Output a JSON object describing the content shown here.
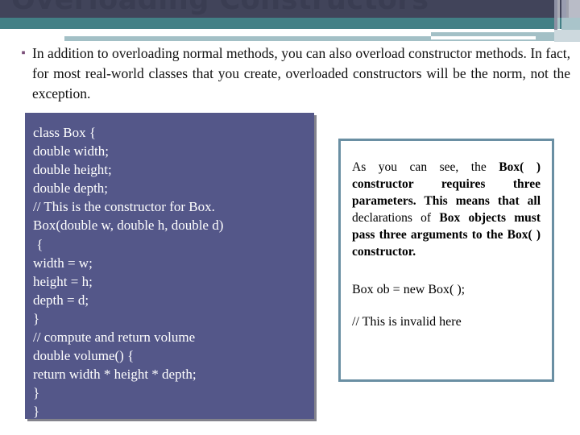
{
  "slide": {
    "title": "Overloading Constructors",
    "header": {
      "colors": {
        "navy": "#41445a",
        "teal": "#428086",
        "light_blue": "#a3c0c6",
        "stripe_gray": "#9a9db0",
        "title_text": "#3a3d52"
      }
    },
    "bullet": {
      "marker": "square-bullet-icon",
      "marker_glyph": "▪",
      "marker_color": "#7b4f79",
      "text": "In addition to overloading normal methods, you can also overload constructor methods. In fact, for most real-world classes that you create, overloaded constructors will be the norm, not the exception."
    },
    "code_box": {
      "background": "#545789",
      "text_color": "#ffffff",
      "lines": [
        "class Box {",
        "double width;",
        "double height;",
        "double depth;",
        "// This is the constructor for Box.",
        "Box(double w, double h, double d)",
        " {",
        "width = w;",
        "height = h;",
        "depth = d;",
        "}",
        "// compute and return volume",
        "double volume() {",
        "return width * height * depth;",
        "}",
        "}"
      ],
      "code": "class Box {\ndouble width;\ndouble height;\ndouble depth;\n// This is the constructor for Box.\nBox(double w, double h, double d)\n {\nwidth = w;\nheight = h;\ndepth = d;\n}\n// compute and return volume\ndouble volume() {\nreturn width * height * depth;\n}\n}"
    },
    "note_box": {
      "border_color": "#6a8fa3",
      "paragraph_plain_1": "As you can see, the ",
      "paragraph_bold_1": "Box( ) constructor requires three parameters. This means that all",
      "paragraph_plain_2": " declarations of ",
      "paragraph_bold_2": "Box objects must pass three arguments to the Box( ) constructor.",
      "paragraph_full": "As you can see, the Box( ) constructor requires three parameters. This means that all declarations of Box objects must pass three arguments to the Box( ) constructor.",
      "code_line_1": "Box ob = new Box( );",
      "code_line_2": "// This is invalid here"
    }
  }
}
